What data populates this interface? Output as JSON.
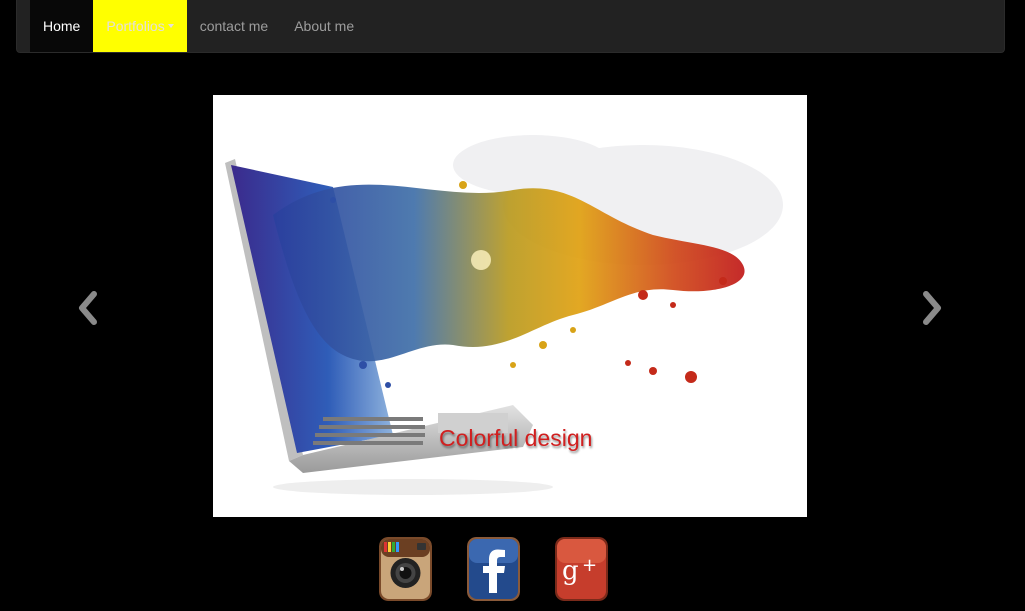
{
  "nav": {
    "items": [
      {
        "label": "Home",
        "state": "active"
      },
      {
        "label": "Portfolios",
        "state": "highlight",
        "dropdown": true
      },
      {
        "label": "contact me"
      },
      {
        "label": "About me"
      }
    ],
    "highlight_color": "#ffff00"
  },
  "carousel": {
    "caption": "Colorful design",
    "caption_color": "#d11f1f",
    "slide_count": 4,
    "active_slide": 1,
    "prev_icon": "chevron-left-icon",
    "next_icon": "chevron-right-icon"
  },
  "social": [
    {
      "icon": "instagram-icon"
    },
    {
      "icon": "facebook-icon"
    },
    {
      "icon": "google-plus-icon"
    }
  ]
}
